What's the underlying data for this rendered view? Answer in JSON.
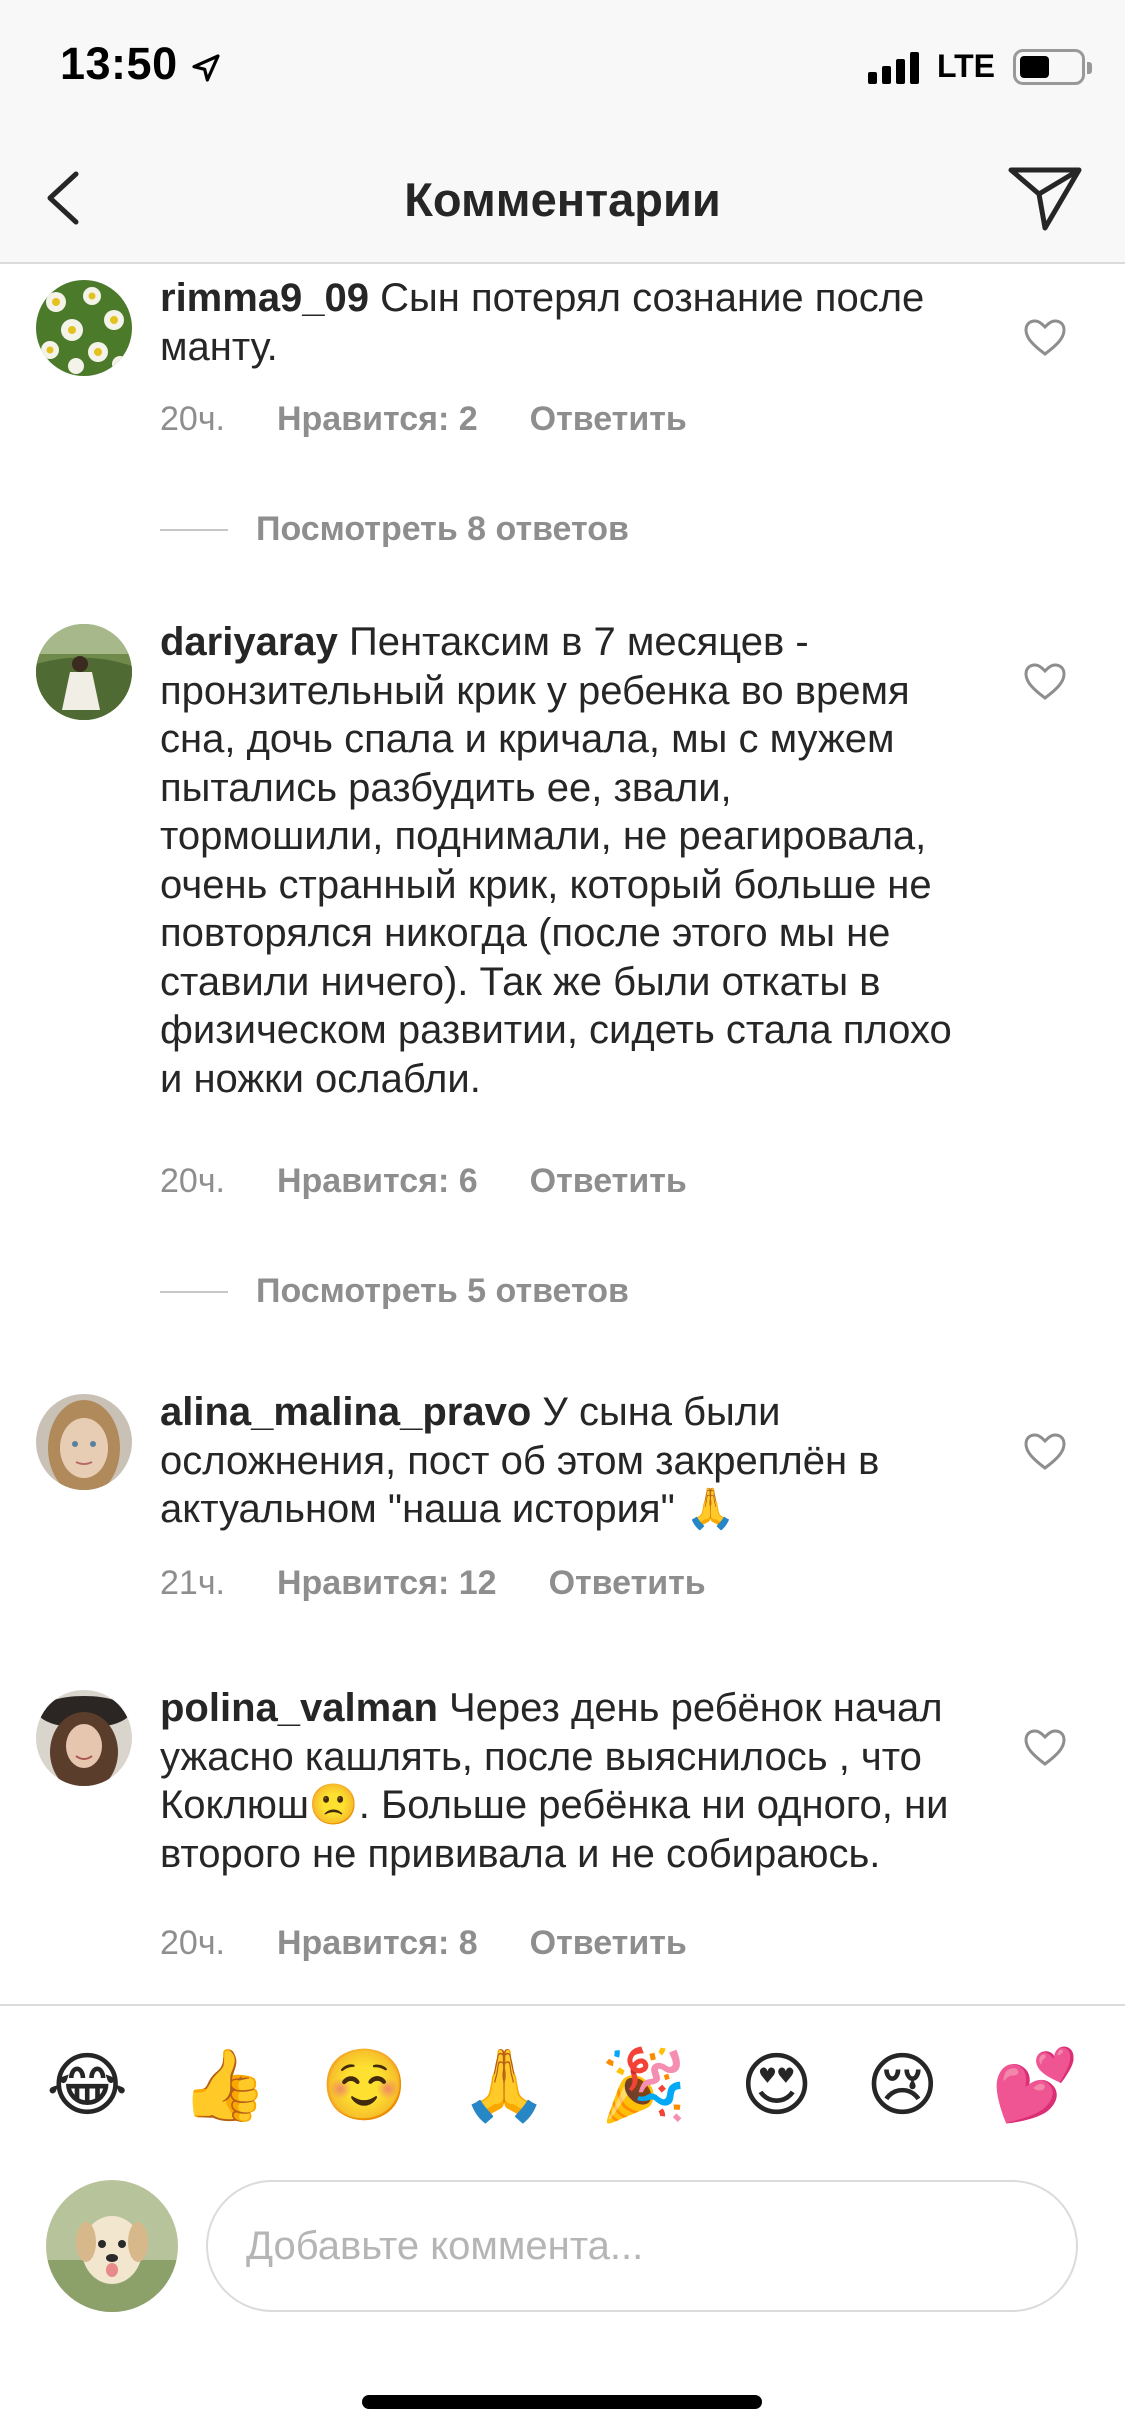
{
  "status_bar": {
    "time": "13:50",
    "network": "LTE"
  },
  "header": {
    "title": "Комментарии"
  },
  "comments": [
    {
      "username": "rimma9_09",
      "text": "Сын потерял сознание после манту.",
      "time": "20ч.",
      "likes": "Нравится: 2",
      "reply": "Ответить",
      "view_replies": "Посмотреть 8 ответов"
    },
    {
      "username": "dariyaray",
      "text": "Пентаксим в 7 месяцев - пронзительный крик у ребенка во время сна, дочь спала и кричала, мы с мужем пытались разбудить ее, звали, тормошили, поднимали, не реагировала, очень странный крик, который больше не повторялся никогда (после этого мы не ставили ничего). Так же были откаты в физическом развитии, сидеть стала плохо и ножки ослабли.",
      "time": "20ч.",
      "likes": "Нравится: 6",
      "reply": "Ответить",
      "view_replies": "Посмотреть 5 ответов"
    },
    {
      "username": "alina_malina_pravo",
      "text": "У сына были осложнения, пост об этом закреплён в актуальном \"наша история\" 🙏",
      "time": "21ч.",
      "likes": "Нравится: 12",
      "reply": "Ответить"
    },
    {
      "username": "polina_valman",
      "text": "Через день ребёнок начал ужасно кашлять, после выяснилось , что Коклюш🙁. Больше ребёнка ни одного, ни второго не прививала и не собираюсь.",
      "time": "20ч.",
      "likes": "Нравится: 8",
      "reply": "Ответить"
    }
  ],
  "emoji_bar": [
    "😂",
    "👍",
    "☺️",
    "🙏",
    "🎉",
    "😍",
    "😢",
    "💕"
  ],
  "composer": {
    "placeholder": "Добавьте коммента..."
  }
}
